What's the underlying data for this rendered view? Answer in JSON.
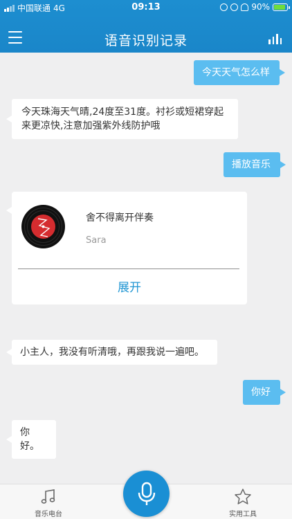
{
  "status_bar": {
    "carrier": "中国联通",
    "network": "4G",
    "time": "09:13",
    "battery": "90%",
    "battery_fraction": 0.9
  },
  "header": {
    "title": "语音识别记录",
    "menu_icon": "hamburger-icon",
    "stats_icon": "bar-chart-icon"
  },
  "messages": [
    {
      "role": "user",
      "text": "今天天气怎么样"
    },
    {
      "role": "bot",
      "text": "今天珠海天气晴,24度至31度。衬衫或短裙穿起来更凉快,注意加强紫外线防护哦"
    },
    {
      "role": "user",
      "text": "播放音乐"
    },
    {
      "role": "bot",
      "text": "小主人，我没有听清哦，再跟我说一遍吧。"
    },
    {
      "role": "user",
      "text": "你好"
    },
    {
      "role": "bot",
      "text": "你好。"
    }
  ],
  "music_card": {
    "song": "舍不得离开伴奏",
    "artist": "Sara",
    "expand_label": "展开"
  },
  "tab_bar": {
    "left_label": "音乐电台",
    "right_label": "实用工具",
    "left_icon": "music-note-icon",
    "right_icon": "star-icon",
    "center_icon": "microphone-icon"
  },
  "colors": {
    "header": "#1a86c9",
    "user_bubble": "#5bbdf0",
    "accent": "#2196d3",
    "background": "#efeff0"
  }
}
